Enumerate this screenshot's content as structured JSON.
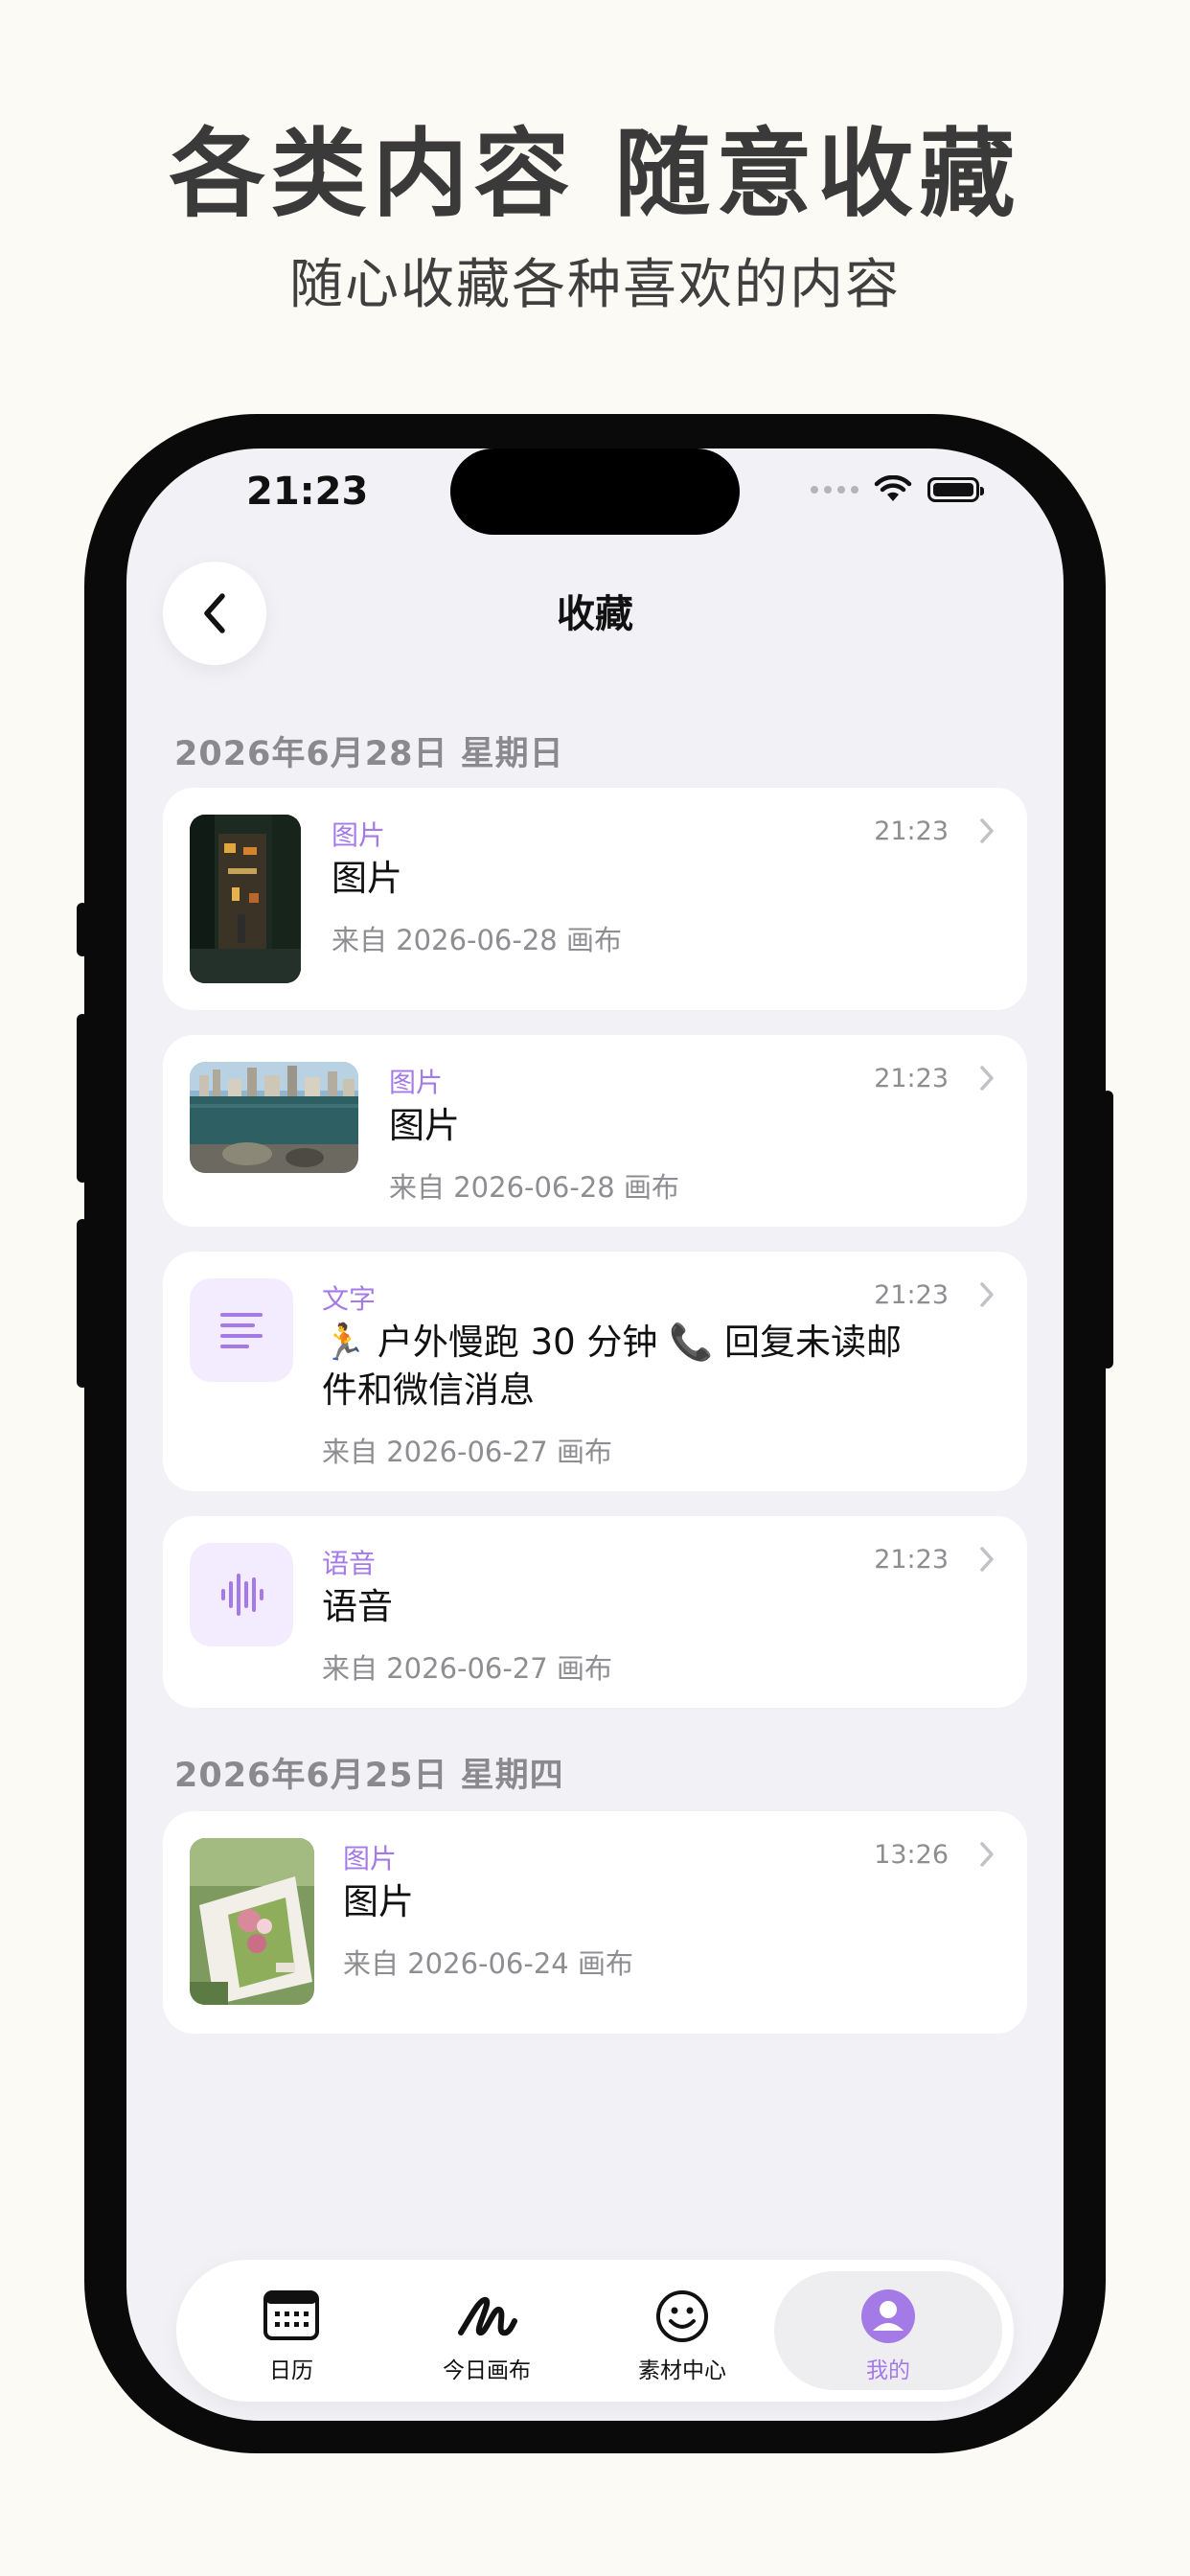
{
  "hero": {
    "title": "各类内容 随意收藏",
    "subtitle": "随心收藏各种喜欢的内容"
  },
  "status_bar": {
    "time": "21:23"
  },
  "nav": {
    "title": "收藏",
    "back_icon": "chevron-left-icon"
  },
  "sections": [
    {
      "date": "2026年6月28日 星期日",
      "items": [
        {
          "type": "图片",
          "time": "21:23",
          "title": "图片",
          "source": "来自 2026-06-28 画布",
          "thumb": "night-street-photo"
        },
        {
          "type": "图片",
          "time": "21:23",
          "title": "图片",
          "source": "来自 2026-06-28 画布",
          "thumb": "harbor-city-photo"
        },
        {
          "type": "文字",
          "time": "21:23",
          "title": "🏃 户外慢跑 30 分钟 📞 回复未读邮件和微信消息",
          "source": "来自 2026-06-27 画布",
          "icon": "text-lines-icon"
        },
        {
          "type": "语音",
          "time": "21:23",
          "title": "语音",
          "source": "来自 2026-06-27 画布",
          "icon": "waveform-icon"
        }
      ]
    },
    {
      "date": "2026年6月25日 星期四",
      "items": [
        {
          "type": "图片",
          "time": "13:26",
          "title": "图片",
          "source": "来自 2026-06-24 画布",
          "thumb": "matcha-dessert-photo"
        }
      ]
    }
  ],
  "tabs": [
    {
      "label": "日历",
      "icon": "calendar-icon",
      "active": false
    },
    {
      "label": "今日画布",
      "icon": "scribble-icon",
      "active": false
    },
    {
      "label": "素材中心",
      "icon": "smiley-icon",
      "active": false
    },
    {
      "label": "我的",
      "icon": "person-icon",
      "active": true
    }
  ],
  "colors": {
    "accent": "#a47ae6",
    "background": "#fcfaf5",
    "screen": "#f2f1f6"
  }
}
